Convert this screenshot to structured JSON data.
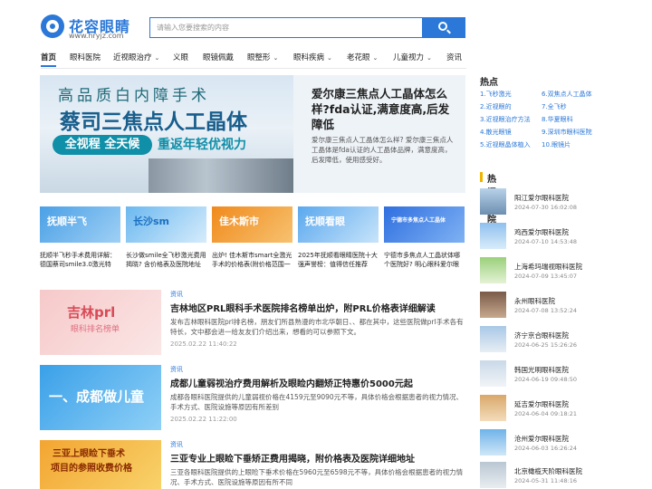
{
  "site": {
    "name": "花容眼睛",
    "url": "www.hryjz.com"
  },
  "search": {
    "placeholder": "请输入您要搜索的内容"
  },
  "nav": [
    {
      "label": "首页",
      "dropdown": false
    },
    {
      "label": "眼科医院",
      "dropdown": false
    },
    {
      "label": "近视眼治疗",
      "dropdown": true
    },
    {
      "label": "义眼",
      "dropdown": false
    },
    {
      "label": "眼镜佩戴",
      "dropdown": false
    },
    {
      "label": "眼整形",
      "dropdown": true
    },
    {
      "label": "眼科疾病",
      "dropdown": true
    },
    {
      "label": "老花眼",
      "dropdown": true
    },
    {
      "label": "儿童视力",
      "dropdown": true
    },
    {
      "label": "资讯",
      "dropdown": false
    }
  ],
  "hero": {
    "banner_line1": "高品质白内障手术",
    "banner_line2": "蔡司三焦点人工晶体",
    "banner_pill": "全视程 全天候",
    "banner_line3": "重返年轻优视力",
    "title": "爱尔康三焦点人工晶体怎么样?fda认证,满意度高,后发障低",
    "desc": "爱尔康三焦点人工晶体怎么样? 爱尔康三焦点人工晶体是fda认证的人工晶体品牌，满意度高，后发障低，使用感受好。"
  },
  "thumbs": [
    {
      "tag": "抚顺半飞",
      "caption": "抚顺半飞秒手术费用详解：德国蔡司smile3.0激光特惠..."
    },
    {
      "tag": "长沙sm",
      "caption": "长沙做smile全飞秒激光费用揭晓? 含价格表及医院地址速..."
    },
    {
      "tag": "佳木斯市",
      "caption": "出炉! 佳木斯市smart全激光手术的价格表(附价格范围一名..."
    },
    {
      "tag": "抚顺看眼",
      "caption": "2025年抚顺看眼睛医院十大强声誉榜：值得信任推荐的..."
    },
    {
      "tag": "宁德市多焦点人工晶体",
      "caption": "宁德市多焦点人工晶状体哪个医院好? 明心眼科爱尔眼科|..."
    }
  ],
  "articles": [
    {
      "img_tag": "吉林prl",
      "img_sub": "眼科排名榜单",
      "category": "资讯",
      "title": "吉林地区PRL眼科手术医院排名榜单出炉，附PRL价格表详细解读",
      "desc": "发布吉林眼科医院prl排名榜，朋友们所县熟漫的市北华朝日、、都在其中，这些医院做prl手术各有特长，文中都会进一给友友们介绍出来，想看的可以参照下文。",
      "date": "2025.02.22 11:40:22"
    },
    {
      "img_tag": "一、成都做儿童",
      "img_sub": "",
      "category": "资讯",
      "title": "成都儿童弱视治疗费用解析及眼睑内翻矫正特惠价5000元起",
      "desc": "成都各眼科医院提供的儿童弱视价格在4159元至9090元不等，具体价格会根据患者的视力情况、手术方式、医院设施等原因有所差别",
      "date": "2025.02.22 11:22:00"
    },
    {
      "img_tag": "三亚上眼睑下垂术",
      "img_sub": "项目的参照收费价格",
      "category": "资讯",
      "title": "三亚专业上眼睑下垂矫正费用揭晓，附价格表及医院详细地址",
      "desc": "三亚各眼科医院提供的上眼睑下垂术价格在5960元至6598元不等，具体价格会根据患者的视力情况、手术方式、医院设施等原因有所不同",
      "date": ""
    }
  ],
  "hot": {
    "title": "热点",
    "items": [
      "1.飞秒激光",
      "6.双焦点人工晶体",
      "2.近视眼的",
      "7.全飞秒",
      "3.近视眼治疗方法",
      "8.华夏眼科",
      "4.散光眼镜",
      "9.深圳市眼科医院",
      "5.近视眼晶体植入",
      "10.眼镜片"
    ]
  },
  "hospitals": {
    "title": "热门医院",
    "items": [
      {
        "name": "阳江爱尔眼科医院",
        "time": "2024-07-30 16:02:08"
      },
      {
        "name": "鸡西爱尔眼科医院",
        "time": "2024-07-10 14:53:48"
      },
      {
        "name": "上海希玛瑞视眼科医院",
        "time": "2024-07-09 13:45:07"
      },
      {
        "name": "永州眼科医院",
        "time": "2024-07-08 13:52:24"
      },
      {
        "name": "济宁京合眼科医院",
        "time": "2024-06-25 15:26:26"
      },
      {
        "name": "韩国光明眼科医院",
        "time": "2024-06-19 09:48:50"
      },
      {
        "name": "延吉爱尔眼科医院",
        "time": "2024-06-04 09:18:21"
      },
      {
        "name": "沧州爱尔眼科医院",
        "time": "2024-06-03 16:26:24"
      },
      {
        "name": "北京橄榄天阶眼科医院",
        "time": "2024-05-31 11:48:16"
      }
    ]
  },
  "colors": {
    "brand": "#2b78d8",
    "accent": "#f0b400"
  }
}
